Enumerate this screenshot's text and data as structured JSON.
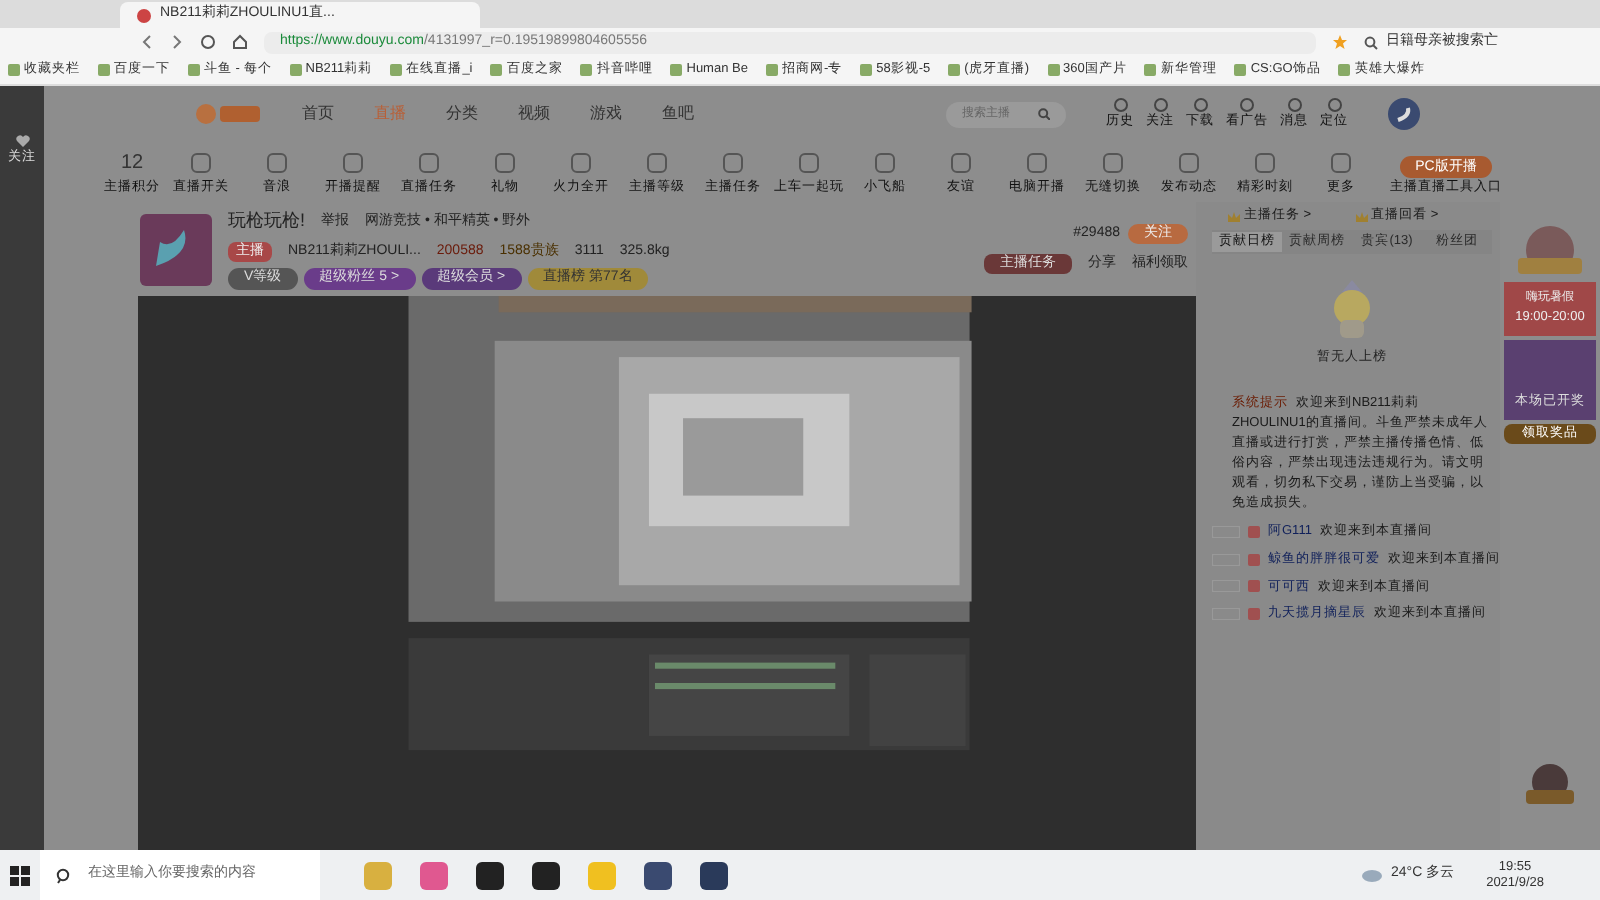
{
  "browser": {
    "tab_title": "NB211莉莉ZHOULINU1直...",
    "url_host": "https://www.douyu.com",
    "url_path": "/4131997_r=0.19519899804605556",
    "search": "日籍母亲被搜索亡",
    "bookmarks": [
      "收藏夹栏",
      "百度一下",
      "斗鱼 - 每个",
      "NB211莉莉",
      "在线直播_i",
      "百度之家",
      "抖音哔哩",
      "Human Be",
      "招商网-专",
      "58影视-5",
      "(虎牙直播)",
      "360国产片",
      "新华管理",
      "CS:GO饰品",
      "英雄大爆炸"
    ]
  },
  "site": {
    "nav": [
      {
        "label": "首页",
        "selected": false
      },
      {
        "label": "直播",
        "selected": true
      },
      {
        "label": "分类",
        "selected": false
      },
      {
        "label": "视频",
        "selected": false
      },
      {
        "label": "游戏",
        "selected": false
      },
      {
        "label": "鱼吧",
        "selected": false
      }
    ],
    "search_placeholder": "搜索主播",
    "header_icons": [
      "历史",
      "关注",
      "下载",
      "看广告",
      "消息",
      "定位"
    ],
    "sidebar": [
      "关注"
    ],
    "score": "12",
    "score_label": "主播积分",
    "tools": [
      "直播开关",
      "音浪",
      "开播提醒",
      "直播任务",
      "礼物",
      "火力全开",
      "主播等级",
      "主播任务",
      "上车一起玩",
      "小飞船",
      "友谊",
      "电脑开播",
      "无缝切换",
      "发布动态",
      "精彩时刻",
      "更多"
    ],
    "pc_button": "PC版开播",
    "pc_sub": "主播直播工具入口"
  },
  "room": {
    "title": "玩枪玩枪!",
    "report": "举报",
    "category": "网游竞技 • 和平精英 • 野外",
    "level": "主播",
    "anchor": "NB211莉莉ZHOULI...",
    "heat": "200588",
    "noble": "1588贵族",
    "fans": "3111",
    "weight": "325.8kg",
    "badges": [
      "V等级",
      "超级粉丝 5 >",
      "超级会员 >",
      "直播榜 第77名"
    ],
    "room_no": "#29488",
    "follow": "关注",
    "promo": "主播任务",
    "share": "分享",
    "welfare": "福利领取"
  },
  "panel": {
    "links": [
      "主播任务 >",
      "直播回看 >"
    ],
    "tabs": [
      {
        "label": "贡献日榜",
        "selected": true
      },
      {
        "label": "贡献周榜",
        "selected": false
      },
      {
        "label": "贵宾(13)",
        "selected": false
      },
      {
        "label": "粉丝团",
        "selected": false
      }
    ],
    "empty": "暂无人上榜",
    "notice_tag": "系统提示",
    "notice": "欢迎来到NB211莉莉ZHOULINU1的直播间。斗鱼严禁未成年人直播或进行打赏，严禁主播传播色情、低俗内容，严禁出现违法违规行为。请文明观看，切勿私下交易，谨防上当受骗，以免造成损失。",
    "chat": [
      {
        "user": "阿G111",
        "text": "欢迎来到本直播间"
      },
      {
        "user": "鲸鱼的胖胖很可爱",
        "text": "欢迎来到本直播间"
      },
      {
        "user": "可可西",
        "text": "欢迎来到本直播间"
      },
      {
        "user": "九天揽月摘星辰",
        "text": "欢迎来到本直播间"
      }
    ],
    "ads": [
      "嗨玩暑假",
      "19:00-20:00",
      "本场已开奖",
      "领取奖品"
    ]
  },
  "taskbar": {
    "search": "在这里输入你要搜索的内容",
    "weather": "24°C 多云",
    "time": "19:55",
    "date": "2021/9/28"
  }
}
